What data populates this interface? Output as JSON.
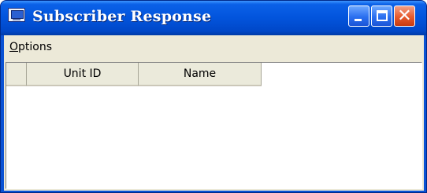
{
  "window": {
    "title": "Subscriber Response",
    "icon": "application-window-icon",
    "controls": [
      "minimize-icon",
      "maximize-icon",
      "close-icon"
    ],
    "close_glyph": "✕"
  },
  "menubar": {
    "items": [
      {
        "label_underlined": "O",
        "label_rest": "ptions"
      }
    ]
  },
  "grid": {
    "columns": [
      "",
      "Unit ID",
      "Name"
    ],
    "rows": []
  },
  "colors": {
    "titlebar": "#0254dc",
    "close_button": "#e65a2c",
    "client_background": "#ece9d8",
    "grid_background": "#ffffff"
  }
}
